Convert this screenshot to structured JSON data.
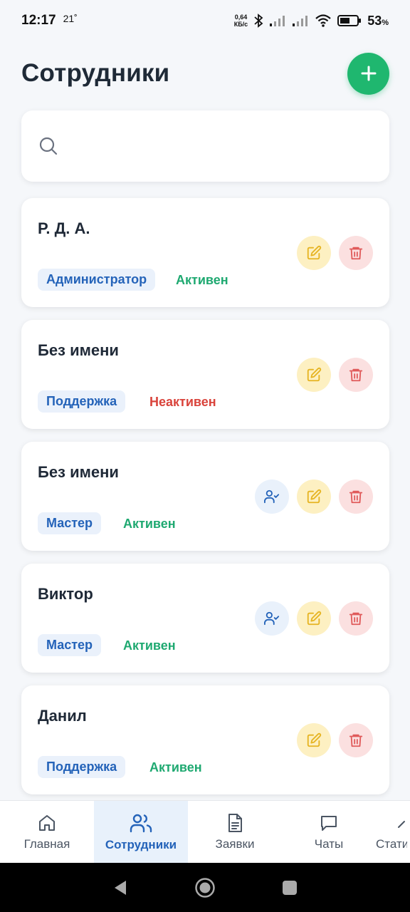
{
  "status_bar": {
    "time": "12:17",
    "temp": "21˚",
    "speed_top": "0,64",
    "speed_bottom": "КБ/с",
    "battery": "53",
    "battery_unit": "%"
  },
  "header": {
    "title": "Сотрудники"
  },
  "search": {
    "placeholder": ""
  },
  "employees": [
    {
      "name": "Р. Д. А.",
      "role": "Администратор",
      "status": "Активен",
      "assign": false
    },
    {
      "name": "Без имени",
      "role": "Поддержка",
      "status": "Неактивен",
      "assign": false
    },
    {
      "name": "Без имени",
      "role": "Мастер",
      "status": "Активен",
      "assign": true
    },
    {
      "name": "Виктор",
      "role": "Мастер",
      "status": "Активен",
      "assign": true
    },
    {
      "name": "Данил",
      "role": "Поддержка",
      "status": "Активен",
      "assign": false
    }
  ],
  "nav": [
    {
      "label": "Главная",
      "icon": "home-icon",
      "active": false
    },
    {
      "label": "Сотрудники",
      "icon": "users-icon",
      "active": true
    },
    {
      "label": "Заявки",
      "icon": "document-icon",
      "active": false
    },
    {
      "label": "Чаты",
      "icon": "chat-icon",
      "active": false
    },
    {
      "label": "Стати",
      "icon": "chart-icon",
      "active": false
    }
  ],
  "colors": {
    "accent": "#1fb76f",
    "primary": "#2463b9",
    "active": "#1fa971",
    "inactive": "#d9433b",
    "edit": "#e6b422",
    "delete": "#e05a5a"
  }
}
